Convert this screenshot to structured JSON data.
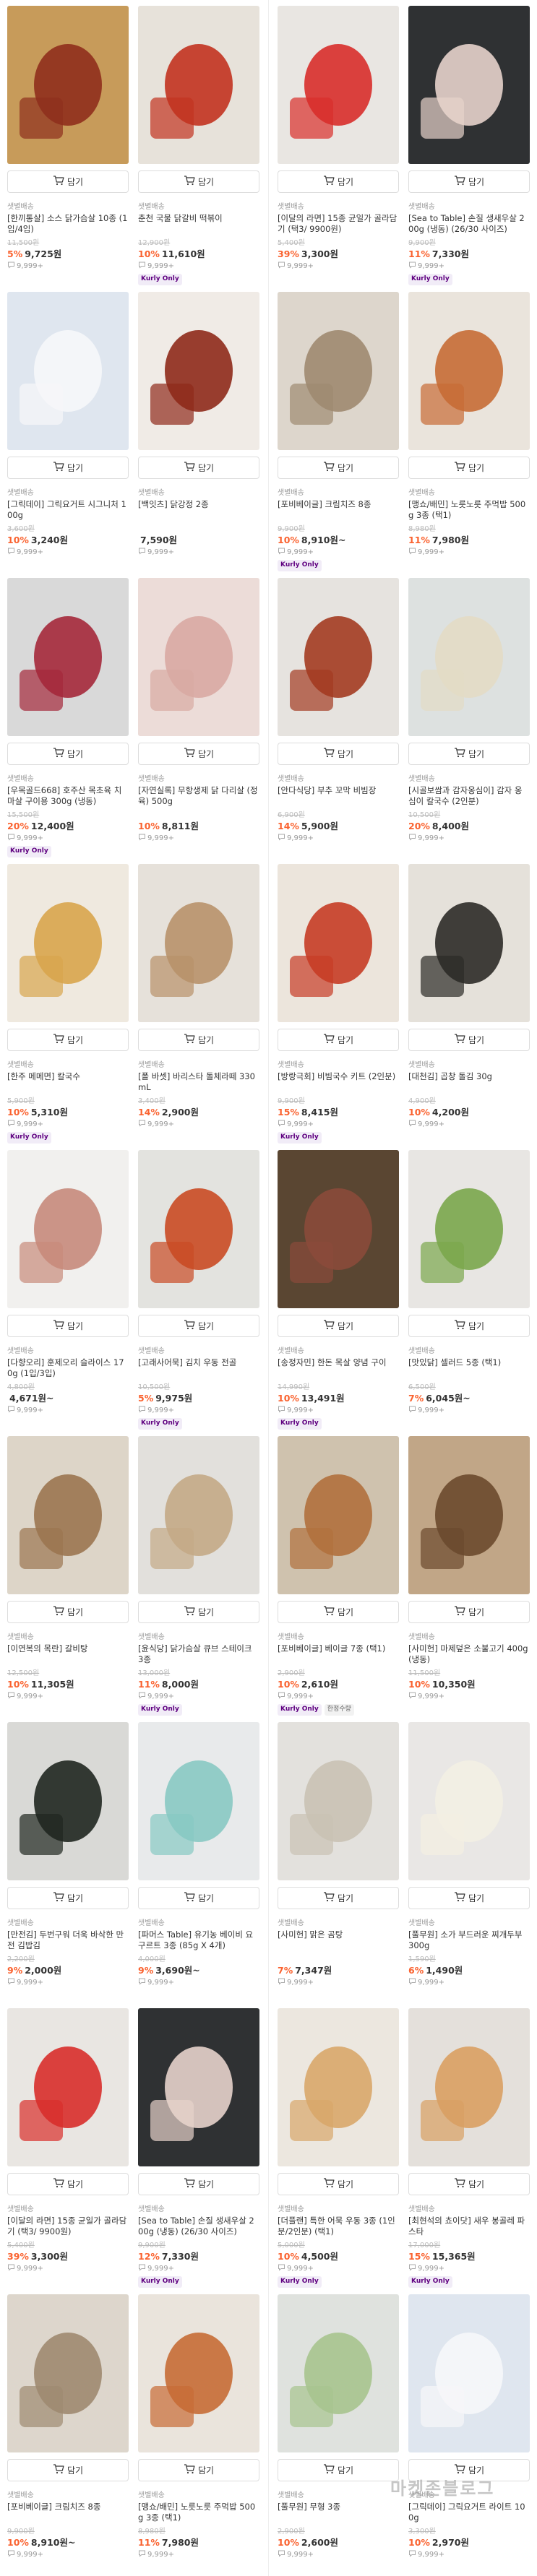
{
  "ui": {
    "cart_label": "담기",
    "shipping_label": "샛별배송",
    "kurly_only_label": "Kurly Only",
    "limited_label": "한정수량"
  },
  "watermark": "마켓존블로그",
  "left_column": [
    {
      "name": "[한끼통살] 소스 닭가슴살 10종 (1입/4입)",
      "original_price": "11,500원",
      "discount": "5%",
      "price": "9,725원",
      "reviews": "9,999+",
      "badges": [],
      "colors": [
        "#c79b5a",
        "#8f2f1c"
      ]
    },
    {
      "name": "춘천 국물 닭갈비 떡볶이",
      "original_price": "12,900원",
      "discount": "10%",
      "price": "11,610원",
      "reviews": "9,999+",
      "badges": [
        "Kurly Only"
      ],
      "colors": [
        "#e7e2da",
        "#c2331f"
      ]
    },
    {
      "name": "[그릭데이] 그릭요거트 시그니처 100g",
      "original_price": "3,600원",
      "discount": "10%",
      "price": "3,240원",
      "reviews": "9,999+",
      "badges": [],
      "colors": [
        "#dfe6ef",
        "#f6f7f9"
      ]
    },
    {
      "name": "[백잇츠] 닭강정 2종",
      "original_price": "",
      "discount": "",
      "price": "7,590원",
      "reviews": "9,999+",
      "badges": [],
      "colors": [
        "#f0ebe6",
        "#8e2a1a"
      ]
    },
    {
      "name": "[우목골드668] 호주산 목초육 치마살 구이용 300g (냉동)",
      "original_price": "15,500원",
      "discount": "20%",
      "price": "12,400원",
      "reviews": "9,999+",
      "badges": [
        "Kurly Only"
      ],
      "colors": [
        "#d9d9d9",
        "#a4283a"
      ]
    },
    {
      "name": "[자연실록] 무항생제 닭 다리살 (정육) 500g",
      "original_price": "",
      "discount": "10%",
      "price": "8,811원",
      "reviews": "9,999+",
      "badges": [],
      "colors": [
        "#ecdcd8",
        "#d9a9a3"
      ]
    },
    {
      "name": "[한주 메메면] 칼국수",
      "original_price": "5,900원",
      "discount": "10%",
      "price": "5,310원",
      "reviews": "9,999+",
      "badges": [
        "Kurly Only"
      ],
      "colors": [
        "#efe9df",
        "#d8a54d"
      ]
    },
    {
      "name": "[폴 바셋] 바리스타 돌체라떼 330mL",
      "original_price": "3,400원",
      "discount": "14%",
      "price": "2,900원",
      "reviews": "9,999+",
      "badges": [],
      "colors": [
        "#e6e1da",
        "#b8926a"
      ]
    },
    {
      "name": "[다향오리] 훈제오리 슬라이스 170g (1입/3입)",
      "original_price": "4,800원",
      "discount": "",
      "price": "4,671원~",
      "reviews": "9,999+",
      "badges": [],
      "colors": [
        "#f1f0ee",
        "#c78a7b"
      ]
    },
    {
      "name": "[고래사어묵] 김치 우동 전골",
      "original_price": "10,500원",
      "discount": "5%",
      "price": "9,975원",
      "reviews": "9,999+",
      "badges": [
        "Kurly Only"
      ],
      "colors": [
        "#e3e3df",
        "#c94a23"
      ]
    },
    {
      "name": "[이연복의 목란] 갈비탕",
      "original_price": "12,500원",
      "discount": "10%",
      "price": "11,305원",
      "reviews": "9,999+",
      "badges": [],
      "colors": [
        "#ddd5c8",
        "#9b7550"
      ]
    },
    {
      "name": "[윤식당] 닭가슴살 큐브 스테이크 3종",
      "original_price": "13,000원",
      "discount": "11%",
      "price": "8,000원",
      "reviews": "9,999+",
      "badges": [
        "Kurly Only"
      ],
      "colors": [
        "#e2e0dc",
        "#c4aa86"
      ]
    },
    {
      "name": "[만전김] 두번구워 더욱 바삭한 만전 김밥김",
      "original_price": "2,200원",
      "discount": "9%",
      "price": "2,000원",
      "reviews": "9,999+",
      "badges": [],
      "colors": [
        "#d9d9d6",
        "#1f2620"
      ]
    },
    {
      "name": "[파머스 Table] 유기농 베이비 요구르트 3종 (85g X 4개)",
      "original_price": "4,000원",
      "discount": "9%",
      "price": "3,690원~",
      "reviews": "9,999+",
      "badges": [],
      "colors": [
        "#e8eaeb",
        "#88c9c3"
      ]
    },
    {
      "name": "[이달의 라면] 15종 균일가 골라담기 (택3/ 9900원)",
      "original_price": "5,400원",
      "discount": "39%",
      "price": "3,300원",
      "reviews": "9,999+",
      "badges": [],
      "colors": [
        "#e9e6e2",
        "#d82d2b"
      ]
    },
    {
      "name": "[Sea to Table] 손질 생새우살 200g (냉동) (26/30 사이즈)",
      "original_price": "9,900원",
      "discount": "12%",
      "price": "7,330원",
      "reviews": "9,999+",
      "badges": [
        "Kurly Only"
      ],
      "colors": [
        "#2f3133",
        "#e7d3cb"
      ]
    },
    {
      "name": "[포비베이글] 크림치즈 8종",
      "original_price": "9,900원",
      "discount": "10%",
      "price": "8,910원~",
      "reviews": "9,999+",
      "badges": [],
      "colors": [
        "#ddd6cc",
        "#9e8a70"
      ]
    },
    {
      "name": "[맹쇼/배민] 노릇노릇 주먹밥 500g 3종 (택1)",
      "original_price": "8,980원",
      "discount": "11%",
      "price": "7,980원",
      "reviews": "9,999+",
      "badges": [],
      "colors": [
        "#eae4dc",
        "#c76b35"
      ]
    }
  ],
  "right_column": [
    {
      "name": "[이달의 라면] 15종 균일가 골라담기 (택3/ 9900원)",
      "original_price": "5,400원",
      "discount": "39%",
      "price": "3,300원",
      "reviews": "9,999+",
      "badges": [],
      "colors": [
        "#e9e6e2",
        "#d82d2b"
      ]
    },
    {
      "name": "[Sea to Table] 손질 생새우살 200g (냉동) (26/30 사이즈)",
      "original_price": "9,900원",
      "discount": "11%",
      "price": "7,330원",
      "reviews": "9,999+",
      "badges": [
        "Kurly Only"
      ],
      "colors": [
        "#2f3133",
        "#e7d3cb"
      ]
    },
    {
      "name": "[포비베이글] 크림치즈 8종",
      "original_price": "9,900원",
      "discount": "10%",
      "price": "8,910원~",
      "reviews": "9,999+",
      "badges": [
        "Kurly Only"
      ],
      "colors": [
        "#ddd6cc",
        "#9e8a70"
      ]
    },
    {
      "name": "[맹쇼/배민] 노릇노릇 주먹밥 500g 3종 (택1)",
      "original_price": "8,980원",
      "discount": "11%",
      "price": "7,980원",
      "reviews": "9,999+",
      "badges": [],
      "colors": [
        "#eae4dc",
        "#c76b35"
      ]
    },
    {
      "name": "[안다식당] 부추 꼬막 비빔장",
      "original_price": "6,900원",
      "discount": "14%",
      "price": "5,900원",
      "reviews": "9,999+",
      "badges": [],
      "colors": [
        "#e6e3df",
        "#a33b21"
      ]
    },
    {
      "name": "[시골보쌈과 감자옹심이] 감자 옹심이 칼국수 (2인분)",
      "original_price": "10,500원",
      "discount": "20%",
      "price": "8,400원",
      "reviews": "9,999+",
      "badges": [],
      "colors": [
        "#dde1e0",
        "#e3dbc5"
      ]
    },
    {
      "name": "[방랑극회] 비빔국수 키트 (2인분)",
      "original_price": "9,900원",
      "discount": "15%",
      "price": "8,415원",
      "reviews": "9,999+",
      "badges": [
        "Kurly Only"
      ],
      "colors": [
        "#ece5dc",
        "#c73c25"
      ]
    },
    {
      "name": "[대천김] 곱창 돌김 30g",
      "original_price": "4,900원",
      "discount": "10%",
      "price": "4,200원",
      "reviews": "9,999+",
      "badges": [],
      "colors": [
        "#e5e1da",
        "#2c2b27"
      ]
    },
    {
      "name": "[송정자민] 한돈 목살 양념 구이",
      "original_price": "14,990원",
      "discount": "10%",
      "price": "13,491원",
      "reviews": "9,999+",
      "badges": [
        "Kurly Only"
      ],
      "colors": [
        "#5a4632",
        "#8a4a3a"
      ]
    },
    {
      "name": "[맛있닭] 셀러드 5종 (택1)",
      "original_price": "6,500원",
      "discount": "7%",
      "price": "6,045원~",
      "reviews": "9,999+",
      "badges": [],
      "colors": [
        "#e8e6e3",
        "#7aa64b"
      ]
    },
    {
      "name": "[포비베이글] 베이글 7종 (택1)",
      "original_price": "2,900원",
      "discount": "10%",
      "price": "2,610원",
      "reviews": "9,999+",
      "badges": [
        "Kurly Only",
        "한정수량"
      ],
      "colors": [
        "#cfc2ae",
        "#b0703d"
      ]
    },
    {
      "name": "[사미헌] 마제덮은 소불고기 400g (냉동)",
      "original_price": "11,500원",
      "discount": "10%",
      "price": "10,350원",
      "reviews": "9,999+",
      "badges": [],
      "colors": [
        "#c1a687",
        "#6b4a2e"
      ]
    },
    {
      "name": "[사미헌] 맑은 곰탕",
      "original_price": "",
      "discount": "7%",
      "price": "7,347원",
      "reviews": "9,999+",
      "badges": [],
      "colors": [
        "#e3e1dd",
        "#c9c2b4"
      ]
    },
    {
      "name": "[풀무원] 소가 부드러운 찌개두부 300g",
      "original_price": "1,590원",
      "discount": "6%",
      "price": "1,490원",
      "reviews": "9,999+",
      "badges": [],
      "colors": [
        "#e9e7e5",
        "#f3efe3"
      ]
    },
    {
      "name": "[더플랜] 특한 어묵 우동 3종 (1인분/2인분) (택1)",
      "original_price": "5,000원",
      "discount": "10%",
      "price": "4,500원",
      "reviews": "9,999+",
      "badges": [
        "Kurly Only"
      ],
      "colors": [
        "#ece7df",
        "#d9a76a"
      ]
    },
    {
      "name": "[최현석의 쵸이닷] 새우 봉골레 파스타",
      "original_price": "17,000원",
      "discount": "15%",
      "price": "15,365원",
      "reviews": "9,999+",
      "badges": [
        "Kurly Only"
      ],
      "colors": [
        "#e4e0db",
        "#d9a062"
      ]
    },
    {
      "name": "[풀무원] 무형 3종",
      "original_price": "2,900원",
      "discount": "10%",
      "price": "2,600원",
      "reviews": "9,999+",
      "badges": [],
      "colors": [
        "#dfe2de",
        "#a7c48e"
      ]
    },
    {
      "name": "[그릭데이] 그릭요거트 라이트 100g",
      "original_price": "3,300원",
      "discount": "10%",
      "price": "2,970원",
      "reviews": "9,999+",
      "badges": [],
      "colors": [
        "#dfe6ef",
        "#f6f7f9"
      ]
    }
  ]
}
